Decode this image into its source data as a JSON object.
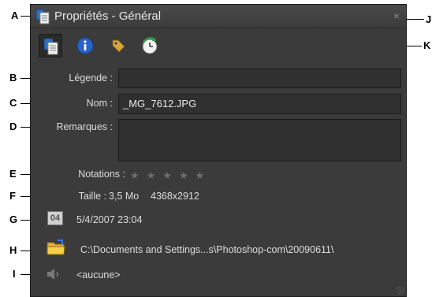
{
  "window": {
    "title": "Propriétés - Général",
    "close_symbol": "×"
  },
  "tabs": [
    {
      "name": "general",
      "icon": "properties-doc-icon"
    },
    {
      "name": "info",
      "icon": "info-icon"
    },
    {
      "name": "tags",
      "icon": "tag-icon"
    },
    {
      "name": "history",
      "icon": "history-clock-icon"
    }
  ],
  "fields": {
    "caption_label": "Légende :",
    "caption_value": "",
    "name_label": "Nom :",
    "name_value": "_MG_7612.JPG",
    "notes_label": "Remarques :",
    "notes_value": "",
    "ratings_label": "Notations :",
    "stars": "★★★★★",
    "size_label": "Taille :",
    "size_value": "3,5 Mo",
    "dimensions_value": "4368x2912",
    "date_icon_text": "04",
    "date_value": "5/4/2007 23:04",
    "path_value": "C:\\Documents and Settings...s\\Photoshop-com\\20090611\\",
    "audio_value": "<aucune>"
  },
  "callouts": {
    "A": "A",
    "B": "B",
    "C": "C",
    "D": "D",
    "E": "E",
    "F": "F",
    "G": "G",
    "H": "H",
    "I": "I",
    "J": "J",
    "K": "K"
  },
  "colors": {
    "panel_bg": "#3b3b3b",
    "field_bg": "#303030",
    "text": "#dcdcdc",
    "star": "#6e6e6e"
  }
}
